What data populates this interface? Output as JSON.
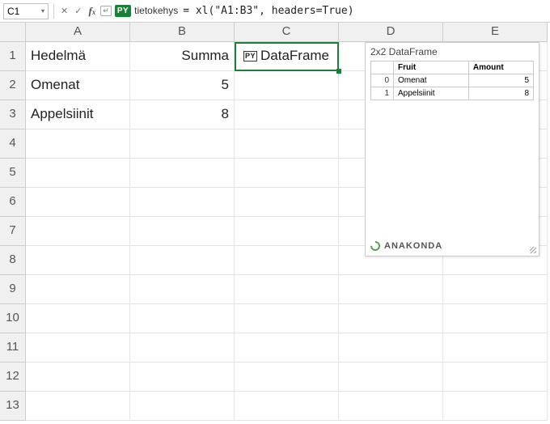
{
  "formula_bar": {
    "cell_ref": "C1",
    "py_badge": "PY",
    "var_name": "tietokehys",
    "formula": "= xl(\"A1:B3\", headers=True)"
  },
  "columns": [
    "A",
    "B",
    "C",
    "D",
    "E"
  ],
  "rows": [
    "1",
    "2",
    "3",
    "4",
    "5",
    "6",
    "7",
    "8",
    "9",
    "10",
    "11",
    "12",
    "13"
  ],
  "cells": {
    "A1": "Hedelmä",
    "B1": "Summa",
    "C1": "DataFrame",
    "A2": "Omenat",
    "B2": "5",
    "A3": "Appelsiinit",
    "B3": "8"
  },
  "py_icon_text": "PY",
  "popup": {
    "title": "2x2 DataFrame",
    "headers": {
      "index": "",
      "c1": "Fruit",
      "c2": "Amount"
    },
    "rows": [
      {
        "idx": "0",
        "c1": "Omenat",
        "c2": "5"
      },
      {
        "idx": "1",
        "c1": "Appelsiinit",
        "c2": "8"
      }
    ],
    "brand": "ANAKONDA"
  },
  "chart_data": {
    "type": "table",
    "title": "2x2 DataFrame",
    "columns": [
      "Fruit",
      "Amount"
    ],
    "rows": [
      [
        "Omenat",
        5
      ],
      [
        "Appelsiinit",
        8
      ]
    ]
  }
}
